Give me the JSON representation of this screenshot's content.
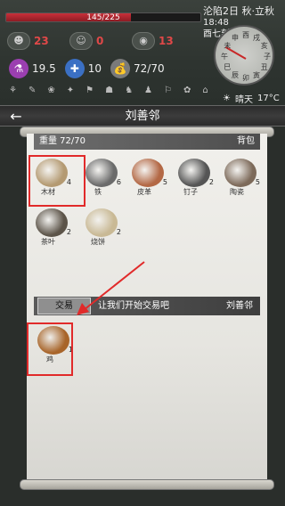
{
  "hud": {
    "hp_text": "145/225",
    "hp_fraction": 0.644,
    "stats": [
      {
        "icon": "brain-icon",
        "glyph": "☻",
        "value": "23"
      },
      {
        "icon": "face-icon",
        "glyph": "☺",
        "value": "0"
      },
      {
        "icon": "stomach-icon",
        "glyph": "◉",
        "value": "13"
      }
    ],
    "resources": [
      {
        "icon": "potion-icon",
        "glyph": "⚗",
        "value": "19.5",
        "color": "#9b3fb0"
      },
      {
        "icon": "bandage-icon",
        "glyph": "✚",
        "value": "10",
        "color": "#3b70c4"
      },
      {
        "icon": "bag-icon",
        "glyph": "💰",
        "value": "72/70",
        "color": "#7a7a7a"
      }
    ],
    "tiny_icons": [
      "⚘",
      "✎",
      "❀",
      "✦",
      "⚑",
      "☗",
      "♞",
      "♟",
      "⚐",
      "✿",
      "⌂"
    ],
    "date": "沦陷2日 秋·立秋",
    "time": "18:48",
    "period": "酉七刻",
    "wheel_labels": [
      "酉",
      "戌",
      "亥",
      "子",
      "丑",
      "寅",
      "卯",
      "辰",
      "巳",
      "午",
      "未",
      "申"
    ],
    "weather": "晴天",
    "temperature": "17°C"
  },
  "title": "刘善邻",
  "inventory": {
    "weight_label": "重量 72/70",
    "tab_label": "背包",
    "items": [
      {
        "name": "木材",
        "count": "4",
        "color": "#b49a72"
      },
      {
        "name": "铁",
        "count": "6",
        "color": "#6b6b6b"
      },
      {
        "name": "皮革",
        "count": "5",
        "color": "#b36845"
      },
      {
        "name": "钉子",
        "count": "2",
        "color": "#555555"
      },
      {
        "name": "陶瓷",
        "count": "5",
        "color": "#7d6a5a"
      },
      {
        "name": "茶叶",
        "count": "2",
        "color": "#5c5449"
      },
      {
        "name": "烧饼",
        "count": "2",
        "color": "#c9b995"
      }
    ]
  },
  "trade": {
    "button": "交易",
    "message": "让我们开始交易吧",
    "npc_name": "刘善邻",
    "npc_items": [
      {
        "name": "鸡",
        "count": "1",
        "color": "#a8652a"
      }
    ]
  }
}
